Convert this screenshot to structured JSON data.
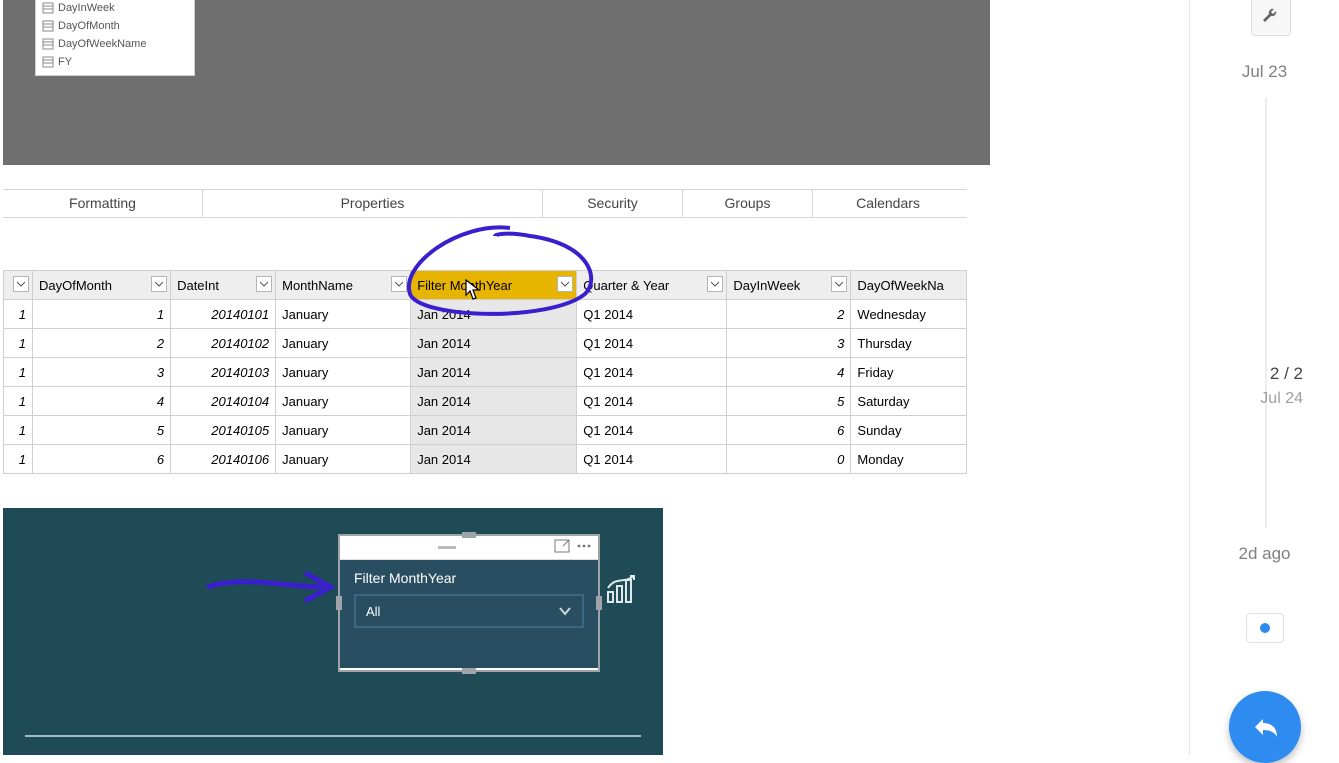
{
  "fields_panel": [
    "DayInWeek",
    "DayOfMonth",
    "DayOfWeekName",
    "FY"
  ],
  "ribbon_tabs": {
    "formatting": "Formatting",
    "properties": "Properties",
    "security": "Security",
    "groups": "Groups",
    "calendars": "Calendars"
  },
  "grid": {
    "headers": {
      "row": "",
      "dayOfMonth": "DayOfMonth",
      "dateInt": "DateInt",
      "monthName": "MonthName",
      "filterMY": "Filter MonthYear",
      "qy": "Quarter & Year",
      "dayInWeek": "DayInWeek",
      "dowName": "DayOfWeekNa"
    },
    "rows": [
      {
        "row": "1",
        "dayOfMonth": "1",
        "dateInt": "20140101",
        "monthName": "January",
        "filterMY": "Jan 2014",
        "qy": "Q1 2014",
        "dayInWeek": "2",
        "dowName": "Wednesday"
      },
      {
        "row": "1",
        "dayOfMonth": "2",
        "dateInt": "20140102",
        "monthName": "January",
        "filterMY": "Jan 2014",
        "qy": "Q1 2014",
        "dayInWeek": "3",
        "dowName": "Thursday"
      },
      {
        "row": "1",
        "dayOfMonth": "3",
        "dateInt": "20140103",
        "monthName": "January",
        "filterMY": "Jan 2014",
        "qy": "Q1 2014",
        "dayInWeek": "4",
        "dowName": "Friday"
      },
      {
        "row": "1",
        "dayOfMonth": "4",
        "dateInt": "20140104",
        "monthName": "January",
        "filterMY": "Jan 2014",
        "qy": "Q1 2014",
        "dayInWeek": "5",
        "dowName": "Saturday"
      },
      {
        "row": "1",
        "dayOfMonth": "5",
        "dateInt": "20140105",
        "monthName": "January",
        "filterMY": "Jan 2014",
        "qy": "Q1 2014",
        "dayInWeek": "6",
        "dowName": "Sunday"
      },
      {
        "row": "1",
        "dayOfMonth": "6",
        "dateInt": "20140106",
        "monthName": "January",
        "filterMY": "Jan 2014",
        "qy": "Q1 2014",
        "dayInWeek": "0",
        "dowName": "Monday"
      }
    ]
  },
  "slicer": {
    "title": "Filter MonthYear",
    "value": "All"
  },
  "timeline": {
    "top_date": "Jul 23",
    "position": "2 / 2",
    "pos_date": "Jul 24",
    "bottom": "2d ago"
  }
}
